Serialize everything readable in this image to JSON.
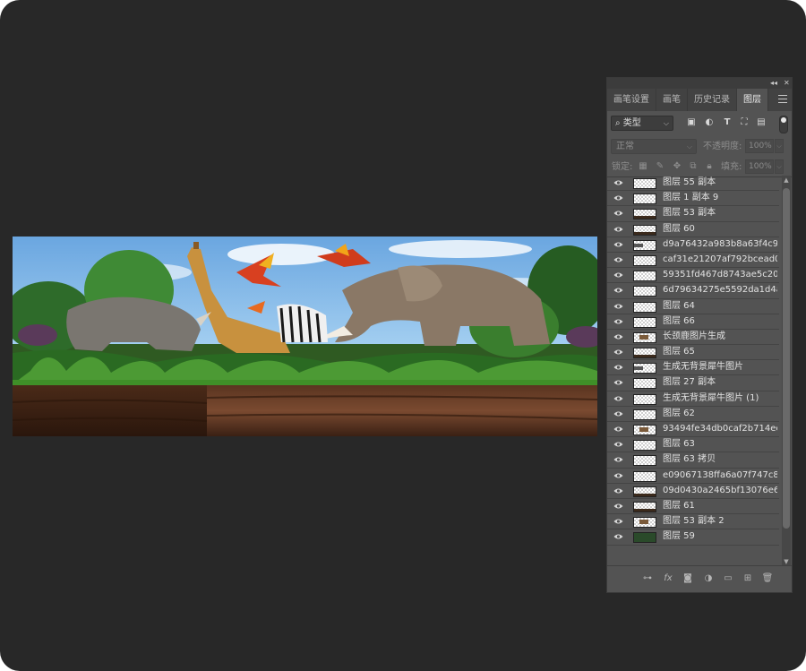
{
  "colors": {
    "workspace_bg": "#282828",
    "panel_bg": "#535353",
    "panel_tab_bg": "#424242",
    "text_light": "#e2e2e2"
  },
  "panel": {
    "tabs": [
      {
        "label": "画笔设置"
      },
      {
        "label": "画笔"
      },
      {
        "label": "历史记录"
      },
      {
        "label": "图层"
      }
    ],
    "active_tab": "图层",
    "filter": {
      "kind_label": "类型",
      "icons": [
        "image-filter-icon",
        "adjustment-filter-icon",
        "type-filter-icon",
        "shape-filter-icon",
        "smart-object-filter-icon"
      ]
    },
    "blend_mode": "正常",
    "opacity_label": "不透明度:",
    "opacity_value": "100%",
    "lock_label": "锁定:",
    "fill_label": "填充:",
    "fill_value": "100%",
    "layers": [
      {
        "name": "图层 55 副本"
      },
      {
        "name": "图层 1 副本 9"
      },
      {
        "name": "图层 53 副本"
      },
      {
        "name": "图层 60"
      },
      {
        "name": "d9a76432a983b8a63f4c9a..."
      },
      {
        "name": "caf31e21207af792bcead0b..."
      },
      {
        "name": "59351fd467d8743ae5c200..."
      },
      {
        "name": "6d79634275e5592da1d4ad..."
      },
      {
        "name": "图层 64"
      },
      {
        "name": "图层 66"
      },
      {
        "name": "长颈鹿图片生成"
      },
      {
        "name": "图层 65"
      },
      {
        "name": "生成无背景犀牛图片"
      },
      {
        "name": "图层 27 副本"
      },
      {
        "name": "生成无背景犀牛图片 (1)"
      },
      {
        "name": "图层 62"
      },
      {
        "name": "93494fe34db0caf2b714ec6..."
      },
      {
        "name": "图层 63"
      },
      {
        "name": "图层 63 拷贝"
      },
      {
        "name": "e09067138ffa6a07f747c82..."
      },
      {
        "name": "09d0430a2465bf13076e67..."
      },
      {
        "name": "图层 61"
      },
      {
        "name": "图层 53 副本 2"
      },
      {
        "name": "图层 59"
      }
    ]
  }
}
